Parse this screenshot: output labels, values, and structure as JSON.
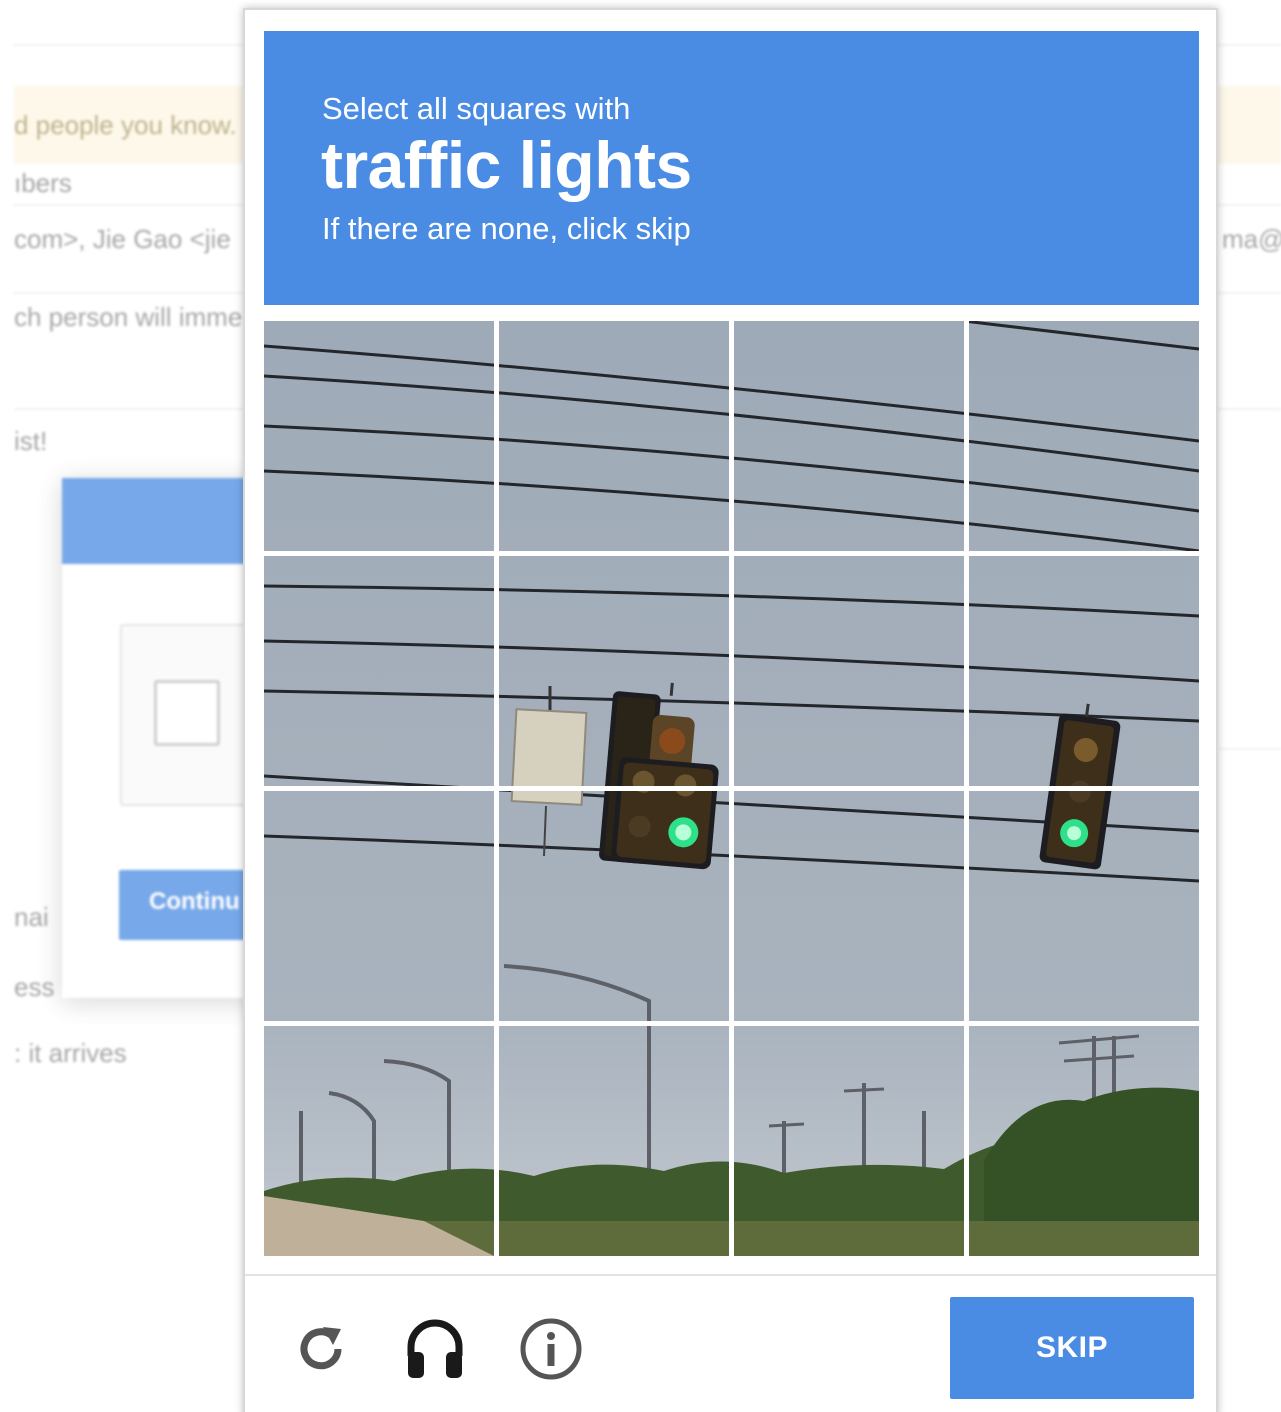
{
  "background": {
    "notice_text": "d people you know.",
    "members_label": "ıbers",
    "recipients_text": "com>, Jie Gao <jie",
    "recipients_tail": "ma@",
    "notice_line": "ch person will imme",
    "list_label": "ist!",
    "dialog": {
      "continue_label": "Continu"
    },
    "email_fragment": "nai",
    "message_fragment": "ess",
    "arrives_fragment": ": it arrives"
  },
  "captcha": {
    "instruction": "Select all squares with",
    "keyword": "traffic lights",
    "hint": "If there are none, click skip",
    "grid": {
      "rows": 4,
      "cols": 4
    },
    "tiles": [
      {
        "row": 1,
        "col": 1
      },
      {
        "row": 1,
        "col": 2
      },
      {
        "row": 1,
        "col": 3
      },
      {
        "row": 1,
        "col": 4
      },
      {
        "row": 2,
        "col": 1
      },
      {
        "row": 2,
        "col": 2
      },
      {
        "row": 2,
        "col": 3
      },
      {
        "row": 2,
        "col": 4
      },
      {
        "row": 3,
        "col": 1
      },
      {
        "row": 3,
        "col": 2
      },
      {
        "row": 3,
        "col": 3
      },
      {
        "row": 3,
        "col": 4
      },
      {
        "row": 4,
        "col": 1
      },
      {
        "row": 4,
        "col": 2
      },
      {
        "row": 4,
        "col": 3
      },
      {
        "row": 4,
        "col": 4
      }
    ],
    "footer": {
      "reload_icon": "reload-icon",
      "audio_icon": "headphones-icon",
      "info_icon": "info-icon",
      "skip_label": "SKIP"
    }
  },
  "colors": {
    "accent": "#4a8ce3",
    "sky": "#a9b3be",
    "signal_green": "#2fe08a"
  }
}
